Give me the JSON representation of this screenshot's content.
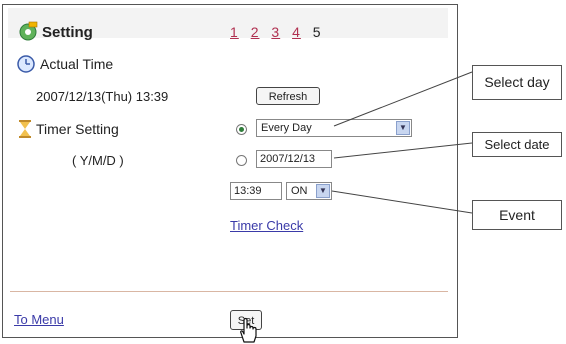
{
  "header": {
    "title": "Setting",
    "pages": [
      "1",
      "2",
      "3",
      "4"
    ],
    "current_page": "5"
  },
  "actual_time": {
    "label": "Actual Time",
    "value": "2007/12/13(Thu) 13:39",
    "refresh_label": "Refresh"
  },
  "timer": {
    "label": "Timer Setting",
    "format_label": "( Y/M/D )",
    "day_select_value": "Every Day",
    "date_value": "2007/12/13",
    "time_value": "13:39",
    "event_value": "ON",
    "check_link": "Timer Check"
  },
  "footer": {
    "menu_link": "To Menu",
    "set_label": "Set"
  },
  "callouts": {
    "select_day": "Select day",
    "select_date": "Select date",
    "event": "Event"
  }
}
